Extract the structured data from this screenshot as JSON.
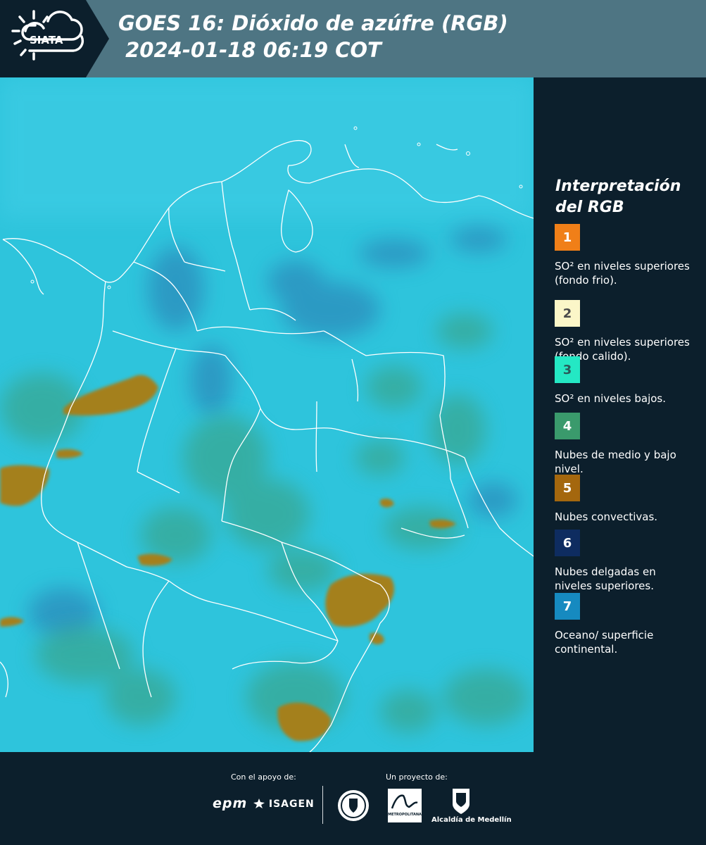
{
  "header": {
    "logo_text": "SIATA",
    "title": "GOES 16: Dióxido de azúfre (RGB)",
    "datetime": "2024-01-18 06:19 COT"
  },
  "legend": {
    "title": "Interpretación del RGB",
    "items": [
      {
        "number": "1",
        "label": "SO² en niveles superiores (fondo frio).",
        "color": "#f07f18",
        "text_color": "#ffffff"
      },
      {
        "number": "2",
        "label": "SO² en niveles superiores (fondo calido).",
        "color": "#fbf6c8",
        "text_color": "#4a4a4a"
      },
      {
        "number": "3",
        "label": "SO² en niveles bajos.",
        "color": "#24e8c4",
        "text_color": "#2a5a5a"
      },
      {
        "number": "4",
        "label": "Nubes de medio y bajo nivel.",
        "color": "#3a9a6c",
        "text_color": "#ffffff"
      },
      {
        "number": "5",
        "label": "Nubes convectivas.",
        "color": "#a4670e",
        "text_color": "#ffffff"
      },
      {
        "number": "6",
        "label": "Nubes delgadas en niveles superiores.",
        "color": "#0e2c60",
        "text_color": "#ffffff"
      },
      {
        "number": "7",
        "label": "Oceano/ superficie continental.",
        "color": "#168ac0",
        "text_color": "#ffffff"
      }
    ]
  },
  "footer": {
    "support_label": "Con el apoyo de:",
    "project_label": "Un proyecto de:",
    "sponsors": [
      "epm",
      "ISAGEN"
    ],
    "partners": [
      "METROPOLITANA",
      "Alcaldía de Medellín"
    ]
  },
  "colors": {
    "background": "#0c1f2c",
    "header": "#4e7583",
    "map_base": "#2ec4dc",
    "clouds_convective": "#a4801e",
    "clouds_low": "#3aa080",
    "thin_high": "#2a70a8"
  }
}
